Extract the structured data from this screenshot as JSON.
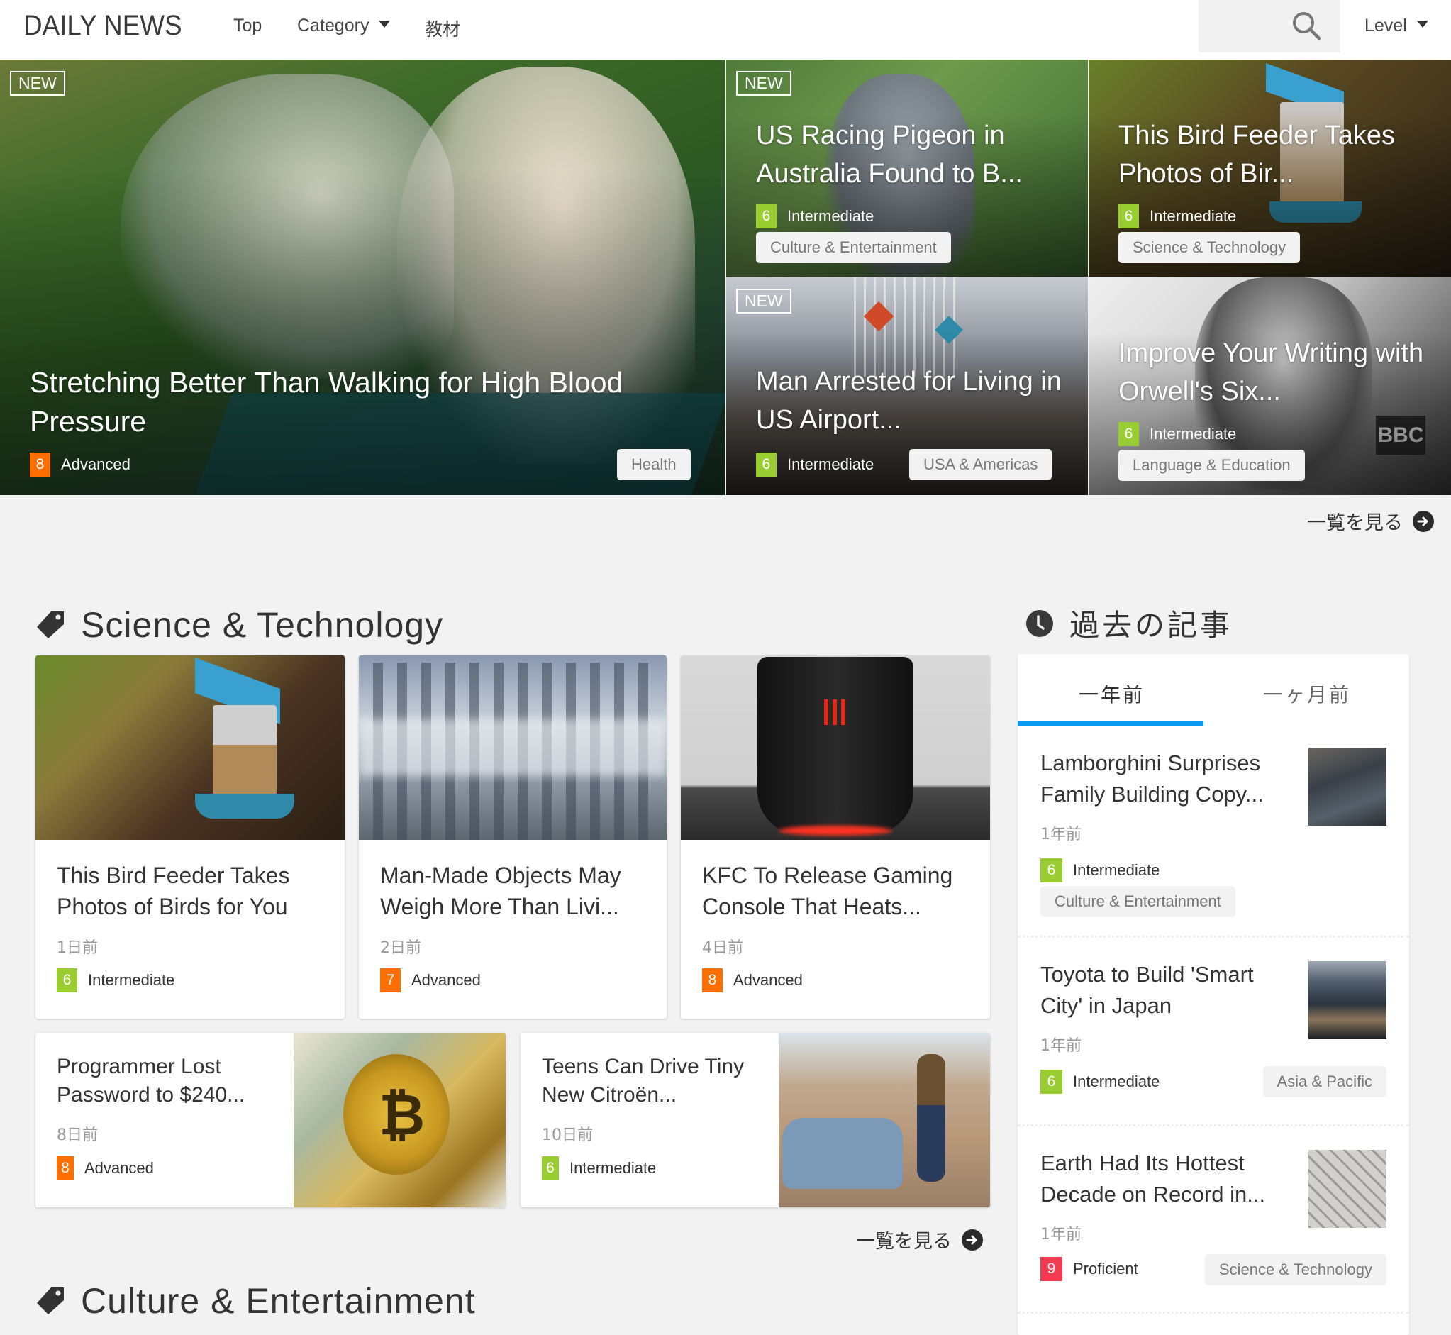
{
  "header": {
    "logo": "DAILY NEWS",
    "nav": [
      {
        "label": "Top"
      },
      {
        "label": "Category",
        "has_dropdown": true
      },
      {
        "label": "教材"
      }
    ],
    "search": {
      "placeholder": "",
      "value": "",
      "icon": "search-icon"
    },
    "level_select": {
      "label": "Level",
      "icon": "caret-down-icon"
    }
  },
  "hero": {
    "main": {
      "badge": "NEW",
      "title": "Stretching Better Than Walking for High Blood Pressure",
      "level_num": "8",
      "level_label": "Advanced",
      "category": "Health"
    },
    "tiles": [
      {
        "badge": "NEW",
        "title": "US Racing Pigeon in Australia Found to B...",
        "level_num": "6",
        "level_label": "Intermediate",
        "category": "Culture & Entertainment"
      },
      {
        "badge": "",
        "title": "This Bird Feeder Takes Photos of Bir...",
        "level_num": "6",
        "level_label": "Intermediate",
        "category": "Science & Technology"
      },
      {
        "badge": "NEW",
        "title": "Man Arrested for Living in US Airport...",
        "level_num": "6",
        "level_label": "Intermediate",
        "category": "USA & Americas"
      },
      {
        "badge": "",
        "title": "Improve Your Writing with Orwell's Six...",
        "level_num": "6",
        "level_label": "Intermediate",
        "category": "Language & Education"
      }
    ],
    "view_all": "一覧を見る"
  },
  "science_section": {
    "heading": "Science & Technology",
    "cards": [
      {
        "title": "This Bird Feeder Takes Photos of Birds for You",
        "date": "1日前",
        "level_num": "6",
        "level_label": "Intermediate"
      },
      {
        "title": "Man-Made Objects May Weigh More Than Livi...",
        "date": "2日前",
        "level_num": "7",
        "level_label": "Advanced"
      },
      {
        "title": "KFC To Release Gaming Console That Heats...",
        "date": "4日前",
        "level_num": "8",
        "level_label": "Advanced"
      }
    ],
    "wide_cards": [
      {
        "title": "Programmer Lost Password to $240...",
        "date": "8日前",
        "level_num": "8",
        "level_label": "Advanced"
      },
      {
        "title": "Teens Can Drive Tiny New Citroën...",
        "date": "10日前",
        "level_num": "6",
        "level_label": "Intermediate"
      }
    ],
    "view_all": "一覧を見る"
  },
  "culture_section": {
    "heading": "Culture & Entertainment"
  },
  "sidebar": {
    "heading": "過去の記事",
    "tabs": [
      {
        "label": "一年前",
        "active": true
      },
      {
        "label": "一ヶ月前",
        "active": false
      }
    ],
    "items": [
      {
        "title": "Lamborghini Surprises Family Building Copy...",
        "date": "1年前",
        "level_num": "6",
        "level_label": "Intermediate",
        "category": "Culture & Entertainment"
      },
      {
        "title": "Toyota to Build 'Smart City' in Japan",
        "date": "1年前",
        "level_num": "6",
        "level_label": "Intermediate",
        "category": "Asia & Pacific"
      },
      {
        "title": "Earth Had Its Hottest Decade on Record in...",
        "date": "1年前",
        "level_num": "9",
        "level_label": "Proficient",
        "category": "Science & Technology"
      }
    ]
  },
  "colors": {
    "level_intermediate": "#9acd32",
    "level_advanced": "#ff6f00",
    "level_proficient": "#f23a50",
    "tab_active": "#0a9af2",
    "page_bg": "#f2f2f2"
  }
}
